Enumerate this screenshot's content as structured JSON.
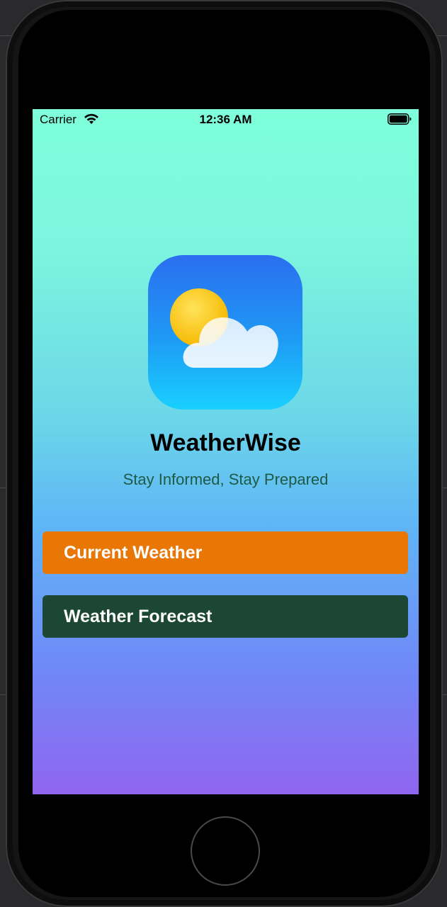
{
  "status_bar": {
    "carrier": "Carrier",
    "time": "12:36 AM",
    "wifi_icon": "wifi-icon",
    "battery_icon": "battery-full-icon"
  },
  "app": {
    "icon": "weather-sun-cloud-icon",
    "title": "WeatherWise",
    "subtitle": "Stay Informed, Stay Prepared"
  },
  "buttons": {
    "current_weather": "Current Weather",
    "weather_forecast": "Weather Forecast"
  },
  "colors": {
    "background_top": "#7fffdc",
    "background_bottom": "#9065ef",
    "current_weather_button": "#e97705",
    "weather_forecast_button": "#1b4734",
    "subtitle_text": "#1f5a46"
  },
  "device": {
    "home_button_icon": "home-button-circle"
  }
}
